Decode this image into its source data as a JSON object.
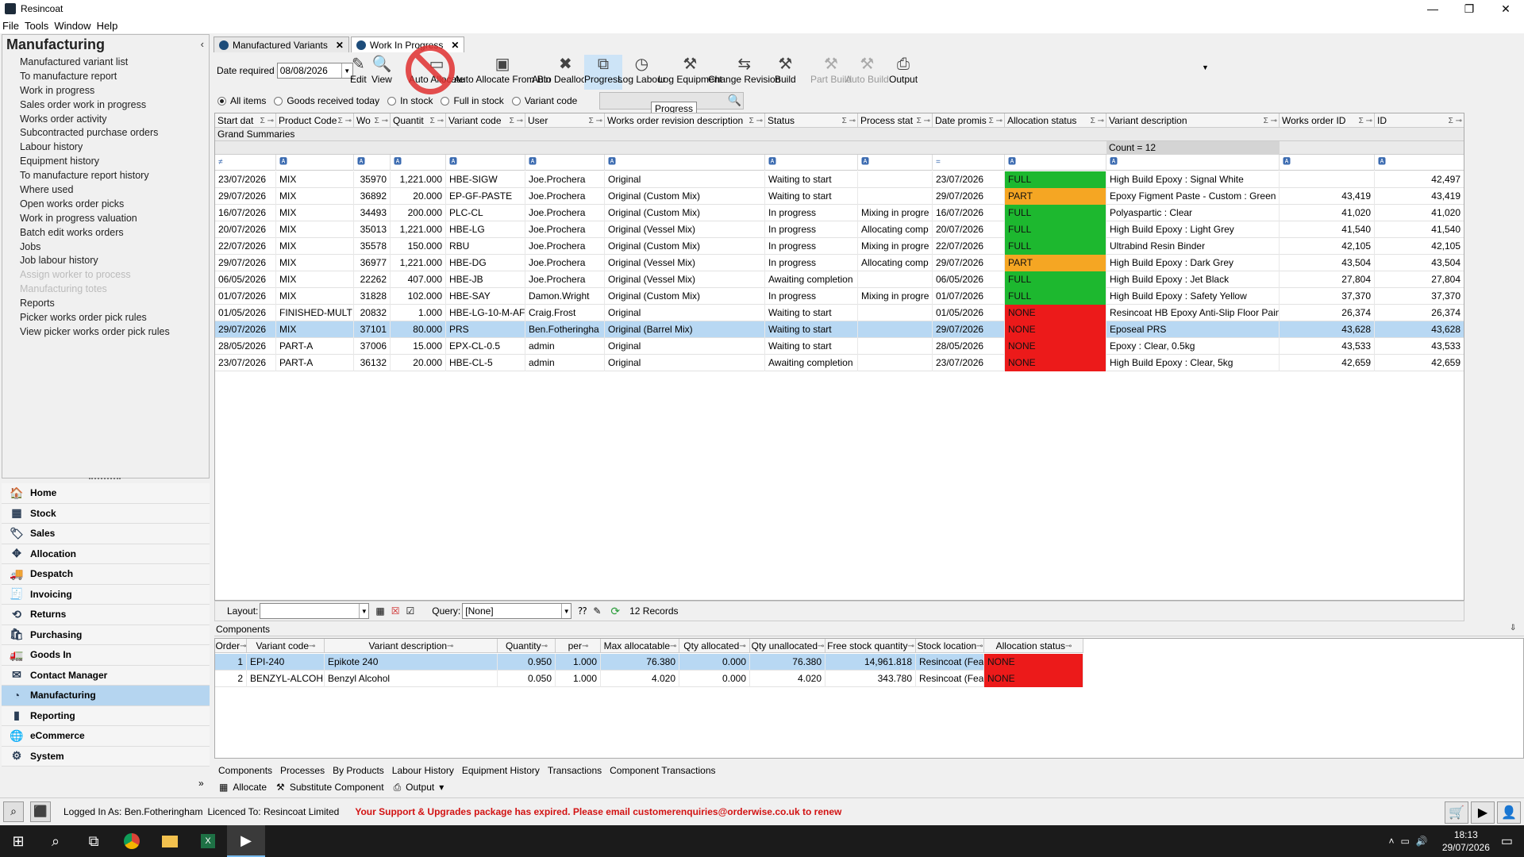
{
  "window": {
    "title": "Resincoat",
    "minimize": "—",
    "restore": "❐",
    "close": "✕"
  },
  "menu": [
    "File",
    "Tools",
    "Window",
    "Help"
  ],
  "left_panel": {
    "title": "Manufacturing",
    "collapse": "‹",
    "items": [
      {
        "label": "Manufactured variant list",
        "enabled": true
      },
      {
        "label": "To manufacture report",
        "enabled": true
      },
      {
        "label": "Work in progress",
        "enabled": true
      },
      {
        "label": "Sales order work in progress",
        "enabled": true
      },
      {
        "label": "Works order activity",
        "enabled": true
      },
      {
        "label": "Subcontracted purchase orders",
        "enabled": true
      },
      {
        "label": "Labour history",
        "enabled": true
      },
      {
        "label": "Equipment history",
        "enabled": true
      },
      {
        "label": "To manufacture report history",
        "enabled": true
      },
      {
        "label": "Where used",
        "enabled": true
      },
      {
        "label": "Open works order picks",
        "enabled": true
      },
      {
        "label": "Work in progress valuation",
        "enabled": true
      },
      {
        "label": "Batch edit works orders",
        "enabled": true
      },
      {
        "label": "Jobs",
        "enabled": true
      },
      {
        "label": "Job labour history",
        "enabled": true
      },
      {
        "label": "Assign worker to process",
        "enabled": false
      },
      {
        "label": "Manufacturing totes",
        "enabled": false
      },
      {
        "label": "Reports",
        "enabled": true
      },
      {
        "label": "Picker works order pick rules",
        "enabled": true
      },
      {
        "label": "View picker works order pick rules",
        "enabled": true
      }
    ]
  },
  "nav": [
    {
      "label": "Home",
      "icon": "🏠",
      "selected": false
    },
    {
      "label": "Stock",
      "icon": "▦",
      "selected": false
    },
    {
      "label": "Sales",
      "icon": "🏷",
      "selected": false
    },
    {
      "label": "Allocation",
      "icon": "✥",
      "selected": false
    },
    {
      "label": "Despatch",
      "icon": "🚚",
      "selected": false
    },
    {
      "label": "Invoicing",
      "icon": "🧾",
      "selected": false
    },
    {
      "label": "Returns",
      "icon": "⟲",
      "selected": false
    },
    {
      "label": "Purchasing",
      "icon": "🛍",
      "selected": false
    },
    {
      "label": "Goods In",
      "icon": "🚛",
      "selected": false
    },
    {
      "label": "Contact Manager",
      "icon": "✉",
      "selected": false
    },
    {
      "label": "Manufacturing",
      "icon": "◔",
      "selected": true
    },
    {
      "label": "Reporting",
      "icon": "▮",
      "selected": false
    },
    {
      "label": "eCommerce",
      "icon": "🌐",
      "selected": false
    },
    {
      "label": "System",
      "icon": "⚙",
      "selected": false
    }
  ],
  "nav_more": "»",
  "tabs": [
    {
      "label": "Manufactured Variants",
      "active": false,
      "close": "✕"
    },
    {
      "label": "Work In Progress",
      "active": true,
      "close": "✕"
    }
  ],
  "toolbar": {
    "date_label": "Date required",
    "date_value": "08/08/2026",
    "buttons": [
      {
        "label": "Edit",
        "icon": "✎",
        "enabled": true,
        "highlight": false
      },
      {
        "label": "View",
        "icon": "🔍",
        "enabled": true,
        "highlight": false
      },
      {
        "label": "Auto Allocate",
        "icon": "▭",
        "enabled": true,
        "highlight": false
      },
      {
        "label": "Auto Allocate From Bin",
        "icon": "▣",
        "enabled": true,
        "highlight": false
      },
      {
        "label": "Auto Deallocate",
        "icon": "✖",
        "enabled": true,
        "highlight": false
      },
      {
        "label": "Progress",
        "icon": "⧉",
        "enabled": true,
        "highlight": true
      },
      {
        "label": "Log Labour",
        "icon": "◷",
        "enabled": true,
        "highlight": false
      },
      {
        "label": "Log Equipment",
        "icon": "⚒",
        "enabled": true,
        "highlight": false
      },
      {
        "label": "Change Revision",
        "icon": "⇆",
        "enabled": true,
        "highlight": false
      },
      {
        "label": "Build",
        "icon": "⚒",
        "enabled": true,
        "highlight": false
      },
      {
        "label": "Part Build",
        "icon": "⚒",
        "enabled": false,
        "highlight": false
      },
      {
        "label": "Auto Build",
        "icon": "⚒",
        "enabled": false,
        "highlight": false
      },
      {
        "label": "Output",
        "icon": "⎙",
        "enabled": true,
        "highlight": false
      }
    ],
    "output_dropdown": "▼"
  },
  "filters": {
    "options": [
      {
        "label": "All items",
        "checked": true
      },
      {
        "label": "Goods received today",
        "checked": false
      },
      {
        "label": "In stock",
        "checked": false
      },
      {
        "label": "Full in stock",
        "checked": false
      },
      {
        "label": "Variant code",
        "checked": false
      }
    ],
    "search_icon": "🔍"
  },
  "tooltip": "Progress",
  "grid": {
    "headers": [
      "Start dat",
      "Product Code",
      "Wo",
      "Quantit",
      "Variant code",
      "User",
      "Works order revision description",
      "Status",
      "Process stat",
      "Date promis",
      "Allocation status",
      "Variant description",
      "Works order ID",
      "ID"
    ],
    "summary_label": "Grand Summaries",
    "count_label": "Count = 12",
    "rows": [
      {
        "start": "23/07/2026",
        "product": "MIX",
        "wo": "35970",
        "qty": "1,221.000",
        "variant": "HBE-SIGW",
        "user": "Joe.Prochera",
        "revision": "Original",
        "status": "Waiting to start",
        "process": "",
        "promised": "23/07/2026",
        "alloc": "FULL",
        "desc": "High Build Epoxy : Signal White",
        "woid": "",
        "id": "42,497",
        "selected": false
      },
      {
        "start": "29/07/2026",
        "product": "MIX",
        "wo": "36892",
        "qty": "20.000",
        "variant": "EP-GF-PASTE",
        "user": "Joe.Prochera",
        "revision": "Original (Custom Mix)",
        "status": "Waiting to start",
        "process": "",
        "promised": "29/07/2026",
        "alloc": "PART",
        "desc": "Epoxy Figment Paste - Custom : Green F",
        "woid": "43,419",
        "id": "43,419",
        "selected": false
      },
      {
        "start": "16/07/2026",
        "product": "MIX",
        "wo": "34493",
        "qty": "200.000",
        "variant": "PLC-CL",
        "user": "Joe.Prochera",
        "revision": "Original (Custom Mix)",
        "status": "In progress",
        "process": "Mixing in progre",
        "promised": "16/07/2026",
        "alloc": "FULL",
        "desc": "Polyaspartic : Clear",
        "woid": "41,020",
        "id": "41,020",
        "selected": false
      },
      {
        "start": "20/07/2026",
        "product": "MIX",
        "wo": "35013",
        "qty": "1,221.000",
        "variant": "HBE-LG",
        "user": "Joe.Prochera",
        "revision": "Original (Vessel Mix)",
        "status": "In progress",
        "process": "Allocating comp",
        "promised": "20/07/2026",
        "alloc": "FULL",
        "desc": "High Build Epoxy : Light Grey",
        "woid": "41,540",
        "id": "41,540",
        "selected": false
      },
      {
        "start": "22/07/2026",
        "product": "MIX",
        "wo": "35578",
        "qty": "150.000",
        "variant": "RBU",
        "user": "Joe.Prochera",
        "revision": "Original (Custom Mix)",
        "status": "In progress",
        "process": "Mixing in progre",
        "promised": "22/07/2026",
        "alloc": "FULL",
        "desc": "Ultrabind Resin Binder",
        "woid": "42,105",
        "id": "42,105",
        "selected": false
      },
      {
        "start": "29/07/2026",
        "product": "MIX",
        "wo": "36977",
        "qty": "1,221.000",
        "variant": "HBE-DG",
        "user": "Joe.Prochera",
        "revision": "Original (Vessel Mix)",
        "status": "In progress",
        "process": "Allocating comp",
        "promised": "29/07/2026",
        "alloc": "PART",
        "desc": "High Build Epoxy : Dark Grey",
        "woid": "43,504",
        "id": "43,504",
        "selected": false
      },
      {
        "start": "06/05/2026",
        "product": "MIX",
        "wo": "22262",
        "qty": "407.000",
        "variant": "HBE-JB",
        "user": "Joe.Prochera",
        "revision": "Original (Vessel Mix)",
        "status": "Awaiting completion",
        "process": "",
        "promised": "06/05/2026",
        "alloc": "FULL",
        "desc": "High Build Epoxy : Jet Black",
        "woid": "27,804",
        "id": "27,804",
        "selected": false
      },
      {
        "start": "01/07/2026",
        "product": "MIX",
        "wo": "31828",
        "qty": "102.000",
        "variant": "HBE-SAY",
        "user": "Damon.Wright",
        "revision": "Original (Custom Mix)",
        "status": "In progress",
        "process": "Mixing in progre",
        "promised": "01/07/2026",
        "alloc": "FULL",
        "desc": "High Build Epoxy : Safety Yellow",
        "woid": "37,370",
        "id": "37,370",
        "selected": false
      },
      {
        "start": "01/05/2026",
        "product": "FINISHED-MULT",
        "wo": "20832",
        "qty": "1.000",
        "variant": "HBE-LG-10-M-AF",
        "user": "Craig.Frost",
        "revision": "Original",
        "status": "Waiting to start",
        "process": "",
        "promised": "01/05/2026",
        "alloc": "NONE",
        "desc": "Resincoat HB Epoxy Anti-Slip Floor Paint",
        "woid": "26,374",
        "id": "26,374",
        "selected": false
      },
      {
        "start": "29/07/2026",
        "product": "MIX",
        "wo": "37101",
        "qty": "80.000",
        "variant": "PRS",
        "user": "Ben.Fotheringha",
        "revision": "Original (Barrel Mix)",
        "status": "Waiting to start",
        "process": "",
        "promised": "29/07/2026",
        "alloc": "NONE",
        "desc": "Eposeal PRS",
        "woid": "43,628",
        "id": "43,628",
        "selected": true
      },
      {
        "start": "28/05/2026",
        "product": "PART-A",
        "wo": "37006",
        "qty": "15.000",
        "variant": "EPX-CL-0.5",
        "user": "admin",
        "revision": "Original",
        "status": "Waiting to start",
        "process": "",
        "promised": "28/05/2026",
        "alloc": "NONE",
        "desc": "Epoxy : Clear, 0.5kg",
        "woid": "43,533",
        "id": "43,533",
        "selected": false
      },
      {
        "start": "23/07/2026",
        "product": "PART-A",
        "wo": "36132",
        "qty": "20.000",
        "variant": "HBE-CL-5",
        "user": "admin",
        "revision": "Original",
        "status": "Awaiting completion",
        "process": "",
        "promised": "23/07/2026",
        "alloc": "NONE",
        "desc": "High Build Epoxy : Clear, 5kg",
        "woid": "42,659",
        "id": "42,659",
        "selected": false
      }
    ]
  },
  "layoutbar": {
    "layout_label": "Layout:",
    "layout_value": "",
    "query_label": "Query:",
    "query_value": "[None]",
    "records": "12 Records"
  },
  "components": {
    "title": "Components",
    "headers": [
      "Order",
      "Variant code",
      "Variant description",
      "Quantity",
      "per",
      "Max allocatable",
      "Qty allocated",
      "Qty unallocated",
      "Free stock quantity",
      "Stock location",
      "Allocation status"
    ],
    "rows": [
      {
        "order": "1",
        "variant": "EPI-240",
        "desc": "Epikote 240",
        "qty": "0.950",
        "per": "1.000",
        "max": "76.380",
        "alloc": "0.000",
        "unalloc": "76.380",
        "free": "14,961.818",
        "loc": "Resincoat (Fea",
        "status": "NONE",
        "selected": true
      },
      {
        "order": "2",
        "variant": "BENZYL-ALCOH",
        "desc": "Benzyl Alcohol",
        "qty": "0.050",
        "per": "1.000",
        "max": "4.020",
        "alloc": "0.000",
        "unalloc": "4.020",
        "free": "343.780",
        "loc": "Resincoat (Fea",
        "status": "NONE",
        "selected": false
      }
    ],
    "tabs": [
      "Components",
      "Processes",
      "By Products",
      "Labour History",
      "Equipment History",
      "Transactions",
      "Component Transactions"
    ],
    "actions": [
      "Allocate",
      "Substitute Component",
      "Output"
    ]
  },
  "statusbar": {
    "login": "Logged In As: Ben.Fotheringham",
    "licence": "Licenced To: Resincoat Limited",
    "warning": "Your Support & Upgrades package has expired. Please email customerenquiries@orderwise.co.uk to renew"
  },
  "taskbar": {
    "time": "18:13",
    "date": "29/07/2026"
  },
  "colors": {
    "full": "#1db82f",
    "part": "#f5a623",
    "none": "#ec1a1a",
    "selection": "#b8d8f3",
    "warning": "#d21212"
  }
}
